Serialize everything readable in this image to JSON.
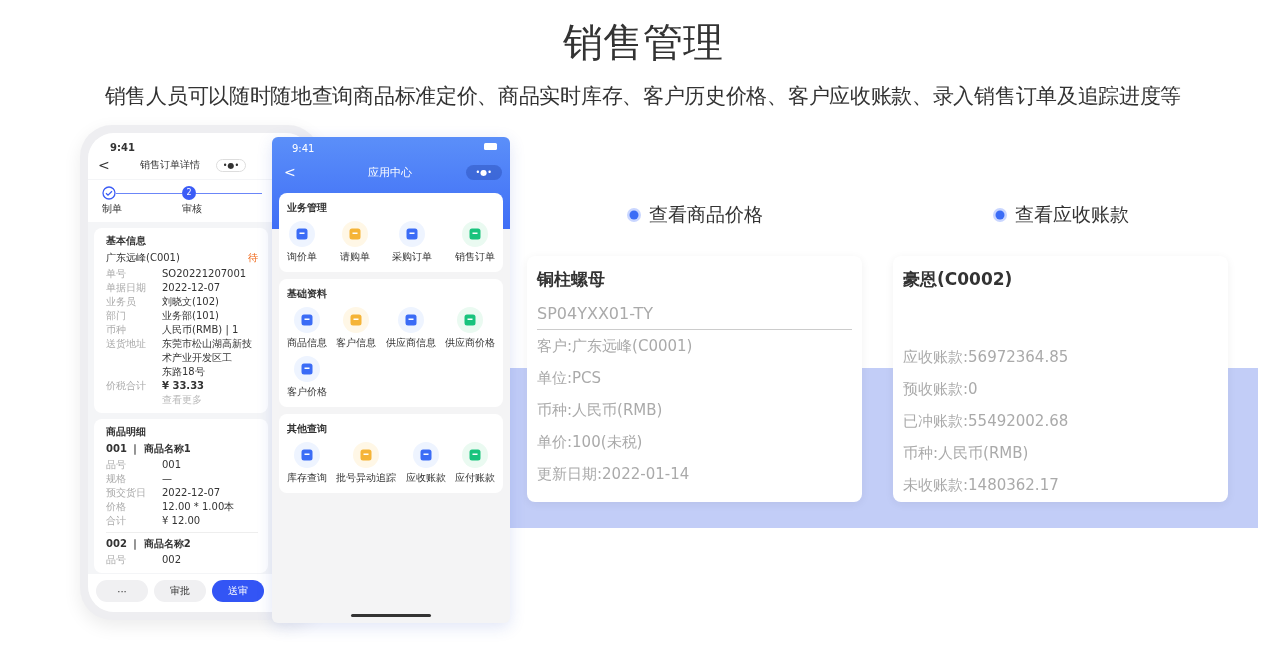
{
  "title": "销售管理",
  "subtitle": "销售人员可以随时随地查询商品标准定价、商品实时库存、客户历史价格、客户应收账款、录入销售订单及追踪进度等",
  "order_phone": {
    "time": "9:41",
    "nav_title": "销售订单详情",
    "back": "<",
    "menu": "•●•",
    "steps": [
      {
        "label": "制单",
        "done": true
      },
      {
        "label": "审核",
        "number": "2",
        "done": false
      }
    ],
    "basic": {
      "heading": "基本信息",
      "customer": "广东远峰(C001)",
      "status": "待",
      "rows": [
        {
          "label": "单号",
          "value": "SO20221207001"
        },
        {
          "label": "单据日期",
          "value": "2022-12-07"
        },
        {
          "label": "业务员",
          "value": "刘晓文(102)"
        },
        {
          "label": "部门",
          "value": "业务部(101)"
        },
        {
          "label": "币种",
          "value": "人民币(RMB) | 1"
        }
      ],
      "address_label": "送货地址",
      "address_lines": [
        "东莞市松山湖高新技术产业开发区工",
        "东路18号"
      ],
      "total_label": "价税合计",
      "total": "¥ 33.33",
      "more": "查看更多"
    },
    "items": {
      "heading": "商品明细",
      "list": [
        {
          "title": "001 ｜ 商品名称1",
          "rows": [
            {
              "label": "品号",
              "value": "001"
            },
            {
              "label": "规格",
              "value": "—"
            },
            {
              "label": "预交货日",
              "value": "2022-12-07"
            },
            {
              "label": "价格",
              "value": "12.00 * 1.00本"
            },
            {
              "label": "合计",
              "value": "¥ 12.00"
            }
          ]
        },
        {
          "title": "002 ｜ 商品名称2",
          "rows": [
            {
              "label": "品号",
              "value": "002"
            }
          ]
        }
      ]
    },
    "buttons": [
      {
        "label": "···",
        "primary": false
      },
      {
        "label": "审批",
        "primary": false
      },
      {
        "label": "送审",
        "primary": true
      }
    ]
  },
  "app_phone": {
    "time": "9:41",
    "back": "<",
    "nav_title": "应用中心",
    "menu": "•●•",
    "sections": [
      {
        "title": "业务管理",
        "items": [
          "询价单",
          "请购单",
          "采购订单",
          "销售订单"
        ]
      },
      {
        "title": "基础资料",
        "items": [
          "商品信息",
          "客户信息",
          "供应商信息",
          "供应商价格",
          "客户价格"
        ]
      },
      {
        "title": "其他查询",
        "items": [
          "库存查询",
          "批号异动追踪",
          "应收账款",
          "应付账款"
        ]
      }
    ]
  },
  "features": [
    {
      "label": "查看商品价格",
      "card": {
        "title": "铜柱螺母",
        "code": "SP04YXX01-TY",
        "lines": [
          "客户:广东远峰(C0001)",
          "单位:PCS",
          "币种:人民币(RMB)",
          "单价:100(未税)",
          "更新日期:2022-01-14"
        ]
      }
    },
    {
      "label": "查看应收账款",
      "card": {
        "title": "豪恩(C0002)",
        "lines": [
          "应收账款:56972364.85",
          "预收账款:0",
          "已冲账款:55492002.68",
          "币种:人民币(RMB)",
          "未收账款:1480362.17"
        ]
      }
    }
  ]
}
